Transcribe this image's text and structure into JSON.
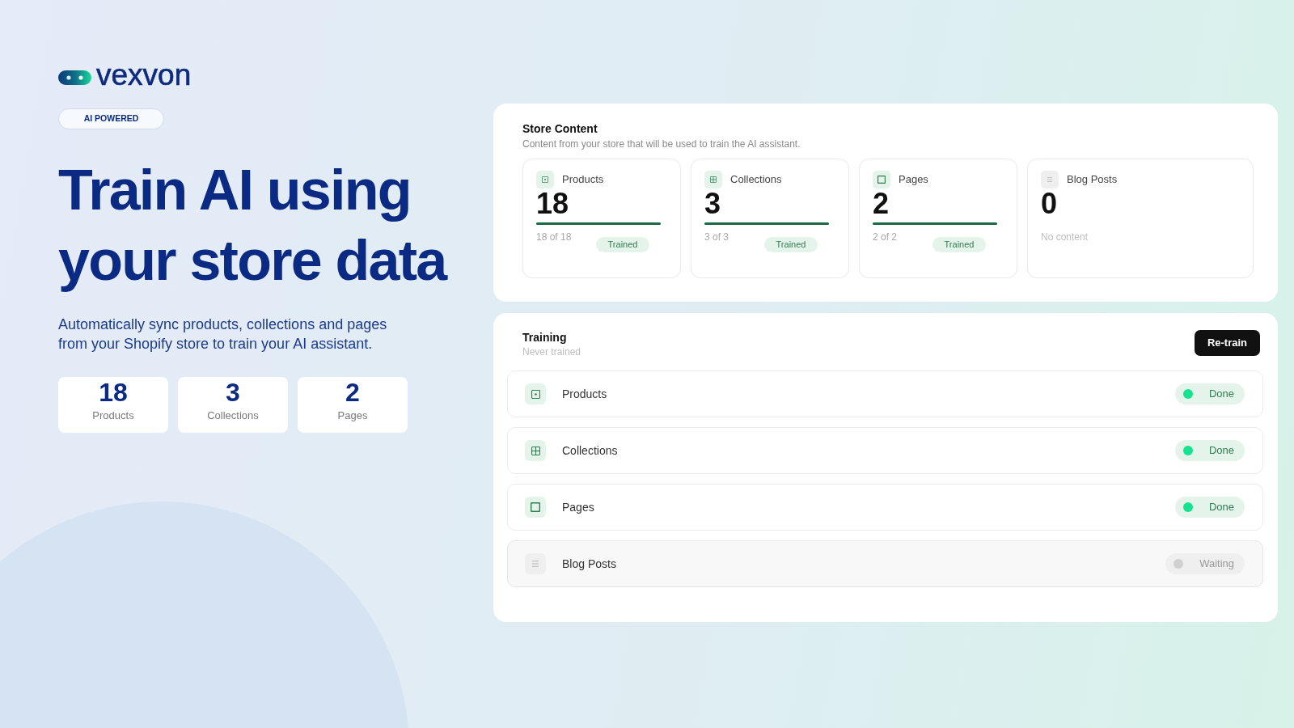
{
  "brand": {
    "name": "vexvon"
  },
  "badge": {
    "label": "AI POWERED"
  },
  "hero": {
    "title": "Train AI using your store data",
    "description": "Automatically sync products, collections and pages from your Shopify store to train your AI assistant."
  },
  "stats": [
    {
      "value": "18",
      "label": "Products"
    },
    {
      "value": "3",
      "label": "Collections"
    },
    {
      "value": "2",
      "label": "Pages"
    }
  ],
  "store_content": {
    "title": "Store Content",
    "subtitle": "Content from your store that will be used to train the AI assistant.",
    "items": [
      {
        "kind": "trained",
        "label": "Products",
        "count": "18",
        "level": 1,
        "progress": "18 of 18",
        "status": "Trained"
      },
      {
        "kind": "trained",
        "label": "Collections",
        "count": "3",
        "level": 1,
        "progress": "3 of 3",
        "status": "Trained"
      },
      {
        "kind": "trained",
        "label": "Pages",
        "count": "2",
        "level": 1,
        "progress": "2 of 2",
        "status": "Trained"
      },
      {
        "kind": "empty",
        "label": "Blog Posts",
        "count": "0",
        "note": "No content"
      }
    ]
  },
  "training": {
    "title": "Training",
    "subtitle": "Never trained",
    "button": "Re-train",
    "rows": [
      {
        "label": "Products",
        "done": true,
        "status": "Done"
      },
      {
        "label": "Collections",
        "done": true,
        "status": "Done"
      },
      {
        "label": "Pages",
        "done": true,
        "status": "Done"
      },
      {
        "label": "Blog Posts",
        "done": false,
        "status": "Waiting"
      }
    ]
  }
}
